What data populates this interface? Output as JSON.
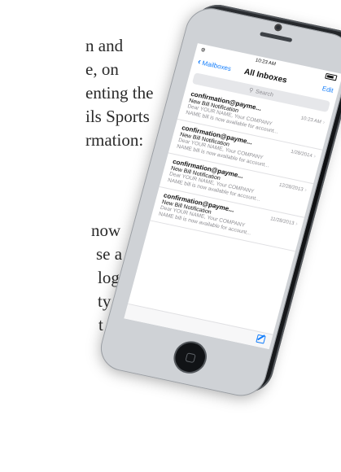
{
  "background_text": [
    "n and",
    "e, on",
    "enting the",
    "ils Sports",
    "rmation:",
    "now",
    "se a",
    "log",
    "ty",
    "t"
  ],
  "phone": {
    "status": {
      "time": "10:23 AM"
    },
    "nav": {
      "back_label": "Mailboxes",
      "title": "All Inboxes",
      "edit_label": "Edit"
    },
    "search": {
      "placeholder": "Search"
    },
    "messages": [
      {
        "sender": "confirmation@payme...",
        "date": "10:23 AM",
        "subject": "New Bill Notification",
        "preview1": "Dear YOUR NAME, Your COMPANY",
        "preview2": "NAME bill is now available for account..."
      },
      {
        "sender": "confirmation@payme...",
        "date": "1/28/2014",
        "subject": "New Bill Notification",
        "preview1": "Dear YOUR NAME, Your COMPANY",
        "preview2": "NAME bill is now available for account..."
      },
      {
        "sender": "confirmation@payme...",
        "date": "12/28/2013",
        "subject": "New Bill Notification",
        "preview1": "Dear YOUR NAME, Your COMPANY",
        "preview2": "NAME bill is now available for account..."
      },
      {
        "sender": "confirmation@payme...",
        "date": "11/28/2013",
        "subject": "New Bill Notification",
        "preview1": "Dear YOUR NAME, Your COMPANY",
        "preview2": "NAME bill is now available for account..."
      }
    ],
    "icons": {
      "back": "chevron-left-icon",
      "search": "search-icon",
      "row_chevron": "chevron-right-icon",
      "compose": "compose-icon",
      "wifi": "wifi-icon",
      "battery": "battery-icon"
    },
    "accent_color": "#147efb"
  }
}
